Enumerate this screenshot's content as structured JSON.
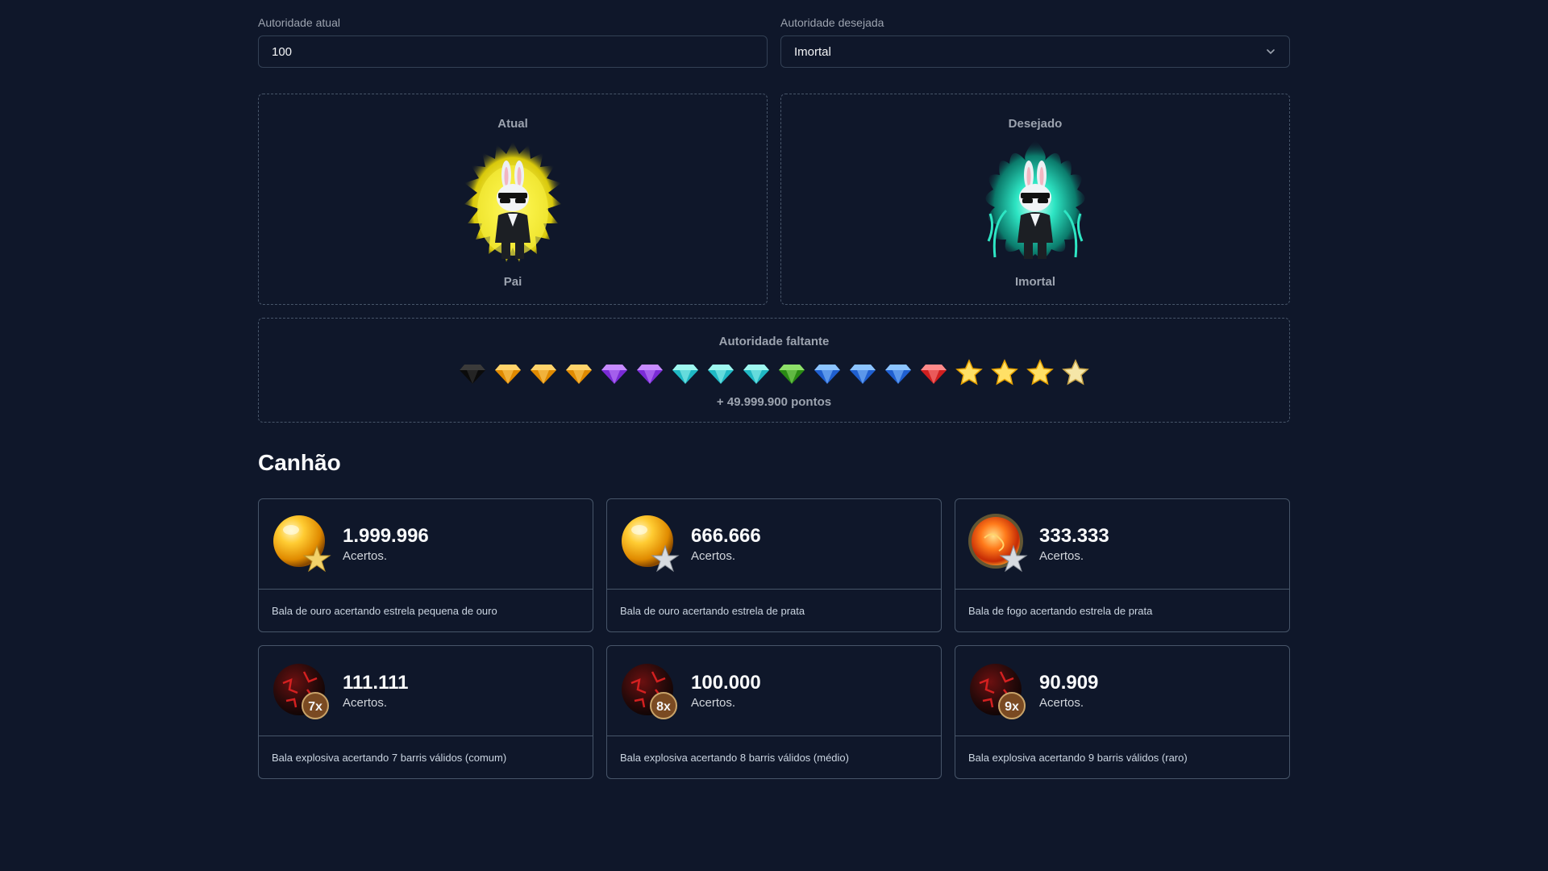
{
  "form": {
    "current_label": "Autoridade atual",
    "current_value": "100",
    "desired_label": "Autoridade desejada",
    "desired_value": "Imortal"
  },
  "current_panel": {
    "title": "Atual",
    "name": "Pai"
  },
  "desired_panel": {
    "title": "Desejado",
    "name": "Imortal"
  },
  "remaining": {
    "title": "Autoridade faltante",
    "points": "+ 49.999.900 pontos",
    "icons": [
      "black-diamond",
      "orange-diamond",
      "orange-diamond",
      "orange-diamond",
      "purple-diamond",
      "purple-diamond",
      "cyan-diamond",
      "cyan-diamond",
      "cyan-diamond",
      "green-diamond",
      "blue-diamond",
      "blue-diamond",
      "blue-diamond",
      "red-diamond",
      "gold-star",
      "gold-star",
      "gold-star",
      "pale-gold-star"
    ]
  },
  "section": {
    "title": "Canhão"
  },
  "cards": [
    {
      "value": "1.999.996",
      "unit": "Acertos.",
      "desc": "Bala de ouro acertando estrela pequena de ouro",
      "icon": "gold-ball-gold-star-icon"
    },
    {
      "value": "666.666",
      "unit": "Acertos.",
      "desc": "Bala de ouro acertando estrela de prata",
      "icon": "gold-ball-silver-star-icon"
    },
    {
      "value": "333.333",
      "unit": "Acertos.",
      "desc": "Bala de fogo acertando estrela de prata",
      "icon": "fire-ball-silver-star-icon"
    },
    {
      "value": "111.111",
      "unit": "Acertos.",
      "desc": "Bala explosiva acertando 7 barris válidos (comum)",
      "icon": "explosive-ball-icon",
      "badge": "7x"
    },
    {
      "value": "100.000",
      "unit": "Acertos.",
      "desc": "Bala explosiva acertando 8 barris válidos (médio)",
      "icon": "explosive-ball-icon",
      "badge": "8x"
    },
    {
      "value": "90.909",
      "unit": "Acertos.",
      "desc": "Bala explosiva acertando 9 barris válidos (raro)",
      "icon": "explosive-ball-icon",
      "badge": "9x"
    }
  ],
  "colors": {
    "background": "#0f172a",
    "border": "#475569",
    "aura_current": "#f5e51c",
    "aura_desired": "#2ee6c4"
  }
}
